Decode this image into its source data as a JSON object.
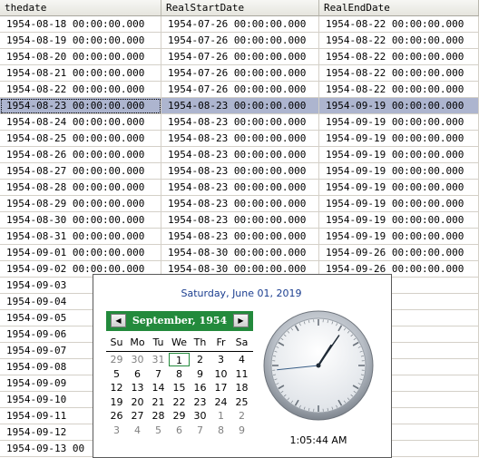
{
  "grid": {
    "columns": [
      "thedate",
      "RealStartDate",
      "RealEndDate"
    ],
    "selected_row": 5,
    "rows": [
      [
        "1954-08-18 00:00:00.000",
        "1954-07-26 00:00:00.000",
        "1954-08-22 00:00:00.000"
      ],
      [
        "1954-08-19 00:00:00.000",
        "1954-07-26 00:00:00.000",
        "1954-08-22 00:00:00.000"
      ],
      [
        "1954-08-20 00:00:00.000",
        "1954-07-26 00:00:00.000",
        "1954-08-22 00:00:00.000"
      ],
      [
        "1954-08-21 00:00:00.000",
        "1954-07-26 00:00:00.000",
        "1954-08-22 00:00:00.000"
      ],
      [
        "1954-08-22 00:00:00.000",
        "1954-07-26 00:00:00.000",
        "1954-08-22 00:00:00.000"
      ],
      [
        "1954-08-23 00:00:00.000",
        "1954-08-23 00:00:00.000",
        "1954-09-19 00:00:00.000"
      ],
      [
        "1954-08-24 00:00:00.000",
        "1954-08-23 00:00:00.000",
        "1954-09-19 00:00:00.000"
      ],
      [
        "1954-08-25 00:00:00.000",
        "1954-08-23 00:00:00.000",
        "1954-09-19 00:00:00.000"
      ],
      [
        "1954-08-26 00:00:00.000",
        "1954-08-23 00:00:00.000",
        "1954-09-19 00:00:00.000"
      ],
      [
        "1954-08-27 00:00:00.000",
        "1954-08-23 00:00:00.000",
        "1954-09-19 00:00:00.000"
      ],
      [
        "1954-08-28 00:00:00.000",
        "1954-08-23 00:00:00.000",
        "1954-09-19 00:00:00.000"
      ],
      [
        "1954-08-29 00:00:00.000",
        "1954-08-23 00:00:00.000",
        "1954-09-19 00:00:00.000"
      ],
      [
        "1954-08-30 00:00:00.000",
        "1954-08-23 00:00:00.000",
        "1954-09-19 00:00:00.000"
      ],
      [
        "1954-08-31 00:00:00.000",
        "1954-08-23 00:00:00.000",
        "1954-09-19 00:00:00.000"
      ],
      [
        "1954-09-01 00:00:00.000",
        "1954-08-30 00:00:00.000",
        "1954-09-26 00:00:00.000"
      ],
      [
        "1954-09-02 00:00:00.000",
        "1954-08-30 00:00:00.000",
        "1954-09-26 00:00:00.000"
      ],
      [
        "1954-09-03",
        "",
        ""
      ],
      [
        "1954-09-04",
        "",
        ""
      ],
      [
        "1954-09-05",
        "",
        ""
      ],
      [
        "1954-09-06",
        "",
        ""
      ],
      [
        "1954-09-07",
        "",
        ""
      ],
      [
        "1954-09-08",
        "",
        ""
      ],
      [
        "1954-09-09",
        "",
        ""
      ],
      [
        "1954-09-10",
        "",
        ""
      ],
      [
        "1954-09-11",
        "",
        ""
      ],
      [
        "1954-09-12",
        "",
        ""
      ],
      [
        "1954-09-13 00",
        "",
        ""
      ]
    ]
  },
  "popup": {
    "current_date": "Saturday, June 01, 2019",
    "calendar": {
      "month_label": "September, 1954",
      "prev_icon": "triangle-left-icon",
      "next_icon": "triangle-right-icon",
      "weekdays": [
        "Su",
        "Mo",
        "Tu",
        "We",
        "Th",
        "Fr",
        "Sa"
      ],
      "weeks": [
        [
          "29",
          "30",
          "31",
          "1",
          "2",
          "3",
          "4"
        ],
        [
          "5",
          "6",
          "7",
          "8",
          "9",
          "10",
          "11"
        ],
        [
          "12",
          "13",
          "14",
          "15",
          "16",
          "17",
          "18"
        ],
        [
          "19",
          "20",
          "21",
          "22",
          "23",
          "24",
          "25"
        ],
        [
          "26",
          "27",
          "28",
          "29",
          "30",
          "1",
          "2"
        ],
        [
          "3",
          "4",
          "5",
          "6",
          "7",
          "8",
          "9"
        ]
      ],
      "selected_day": "1",
      "accent_color": "#238a3c"
    },
    "clock": {
      "time": "1:05:44 AM",
      "hour": 1,
      "minute": 5,
      "second": 44
    }
  }
}
